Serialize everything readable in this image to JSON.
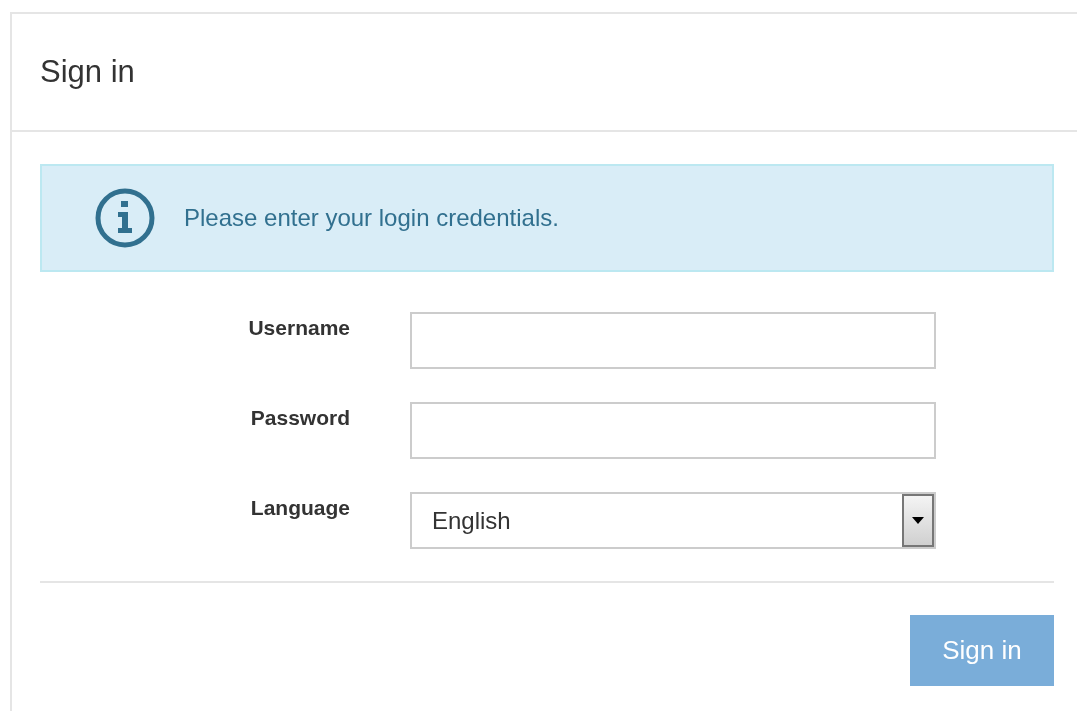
{
  "card": {
    "title": "Sign in"
  },
  "alert": {
    "message": "Please enter your login credentials."
  },
  "fields": [
    {
      "kind": "text",
      "label": "Username"
    },
    {
      "kind": "password",
      "label": "Password"
    },
    {
      "kind": "select",
      "label": "Language",
      "value": "English"
    }
  ],
  "submit": {
    "label": "Sign in",
    "disabled": true
  }
}
